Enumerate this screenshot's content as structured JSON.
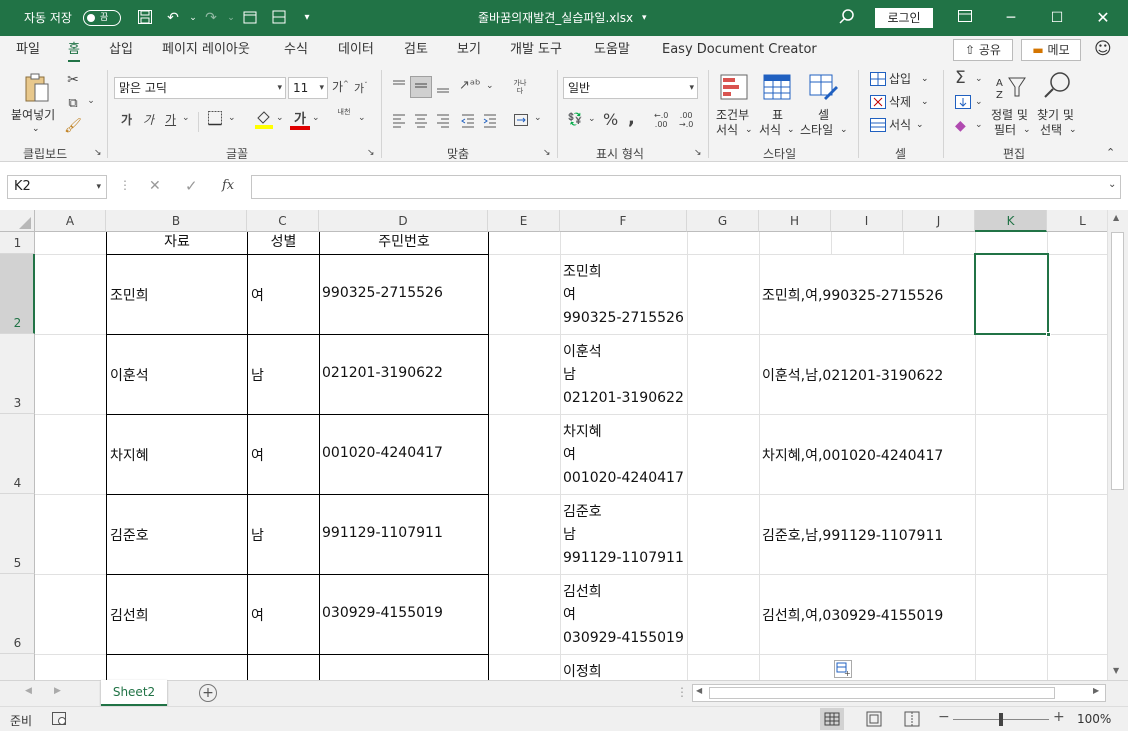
{
  "titlebar": {
    "autosave_label": "자동 저장",
    "autosave_state": "끔",
    "filename": "줄바꿈의재발견_실습파일.xlsx",
    "login_label": "로그인"
  },
  "tabs": [
    "파일",
    "홈",
    "삽입",
    "페이지 레이아웃",
    "수식",
    "데이터",
    "검토",
    "보기",
    "개발 도구",
    "도움말",
    "Easy Document Creator"
  ],
  "active_tab": "홈",
  "share_label": "공유",
  "memo_label": "메모",
  "ribbon": {
    "clipboard": {
      "paste_label": "붙여넣기",
      "group_label": "클립보드"
    },
    "font": {
      "name": "맑은 고딕",
      "size": "11",
      "group_label": "글꼴",
      "bold": "가",
      "italic": "가",
      "underline": "가",
      "font_color_glyph": "가",
      "phonetic": "내천"
    },
    "alignment": {
      "group_label": "맞춤",
      "wrap_glyph": "가나다"
    },
    "number": {
      "format": "일반",
      "group_label": "표시 형식"
    },
    "styles": {
      "conditional": [
        "조건부",
        "서식"
      ],
      "table": [
        "표",
        "서식"
      ],
      "cell": [
        "셀",
        "스타일"
      ],
      "group_label": "스타일"
    },
    "cells": {
      "insert": "삽입",
      "delete": "삭제",
      "format": "서식",
      "group_label": "셀"
    },
    "editing": {
      "sort": [
        "정렬 및",
        "필터"
      ],
      "find": [
        "찾기 및",
        "선택"
      ],
      "group_label": "편집"
    }
  },
  "formula_bar": {
    "name_box": "K2",
    "formula": ""
  },
  "columns": [
    "A",
    "B",
    "C",
    "D",
    "E",
    "F",
    "G",
    "H",
    "I",
    "J",
    "K",
    "L"
  ],
  "selected_column": "K",
  "selected_cell": "K2",
  "header_row": {
    "B": "자료",
    "C": "성별",
    "D": "주민번호"
  },
  "rows": [
    {
      "row": "2",
      "name": "조민희",
      "gender": "여",
      "id": "990325-2715526",
      "F": [
        "조민희",
        "여",
        "990325-2715526"
      ],
      "H": "조민희,여,990325-2715526"
    },
    {
      "row": "3",
      "name": "이훈석",
      "gender": "남",
      "id": "021201-3190622",
      "F": [
        "이훈석",
        "남",
        "021201-3190622"
      ],
      "H": "이훈석,남,021201-3190622"
    },
    {
      "row": "4",
      "name": "차지혜",
      "gender": "여",
      "id": "001020-4240417",
      "F": [
        "차지혜",
        "여",
        "001020-4240417"
      ],
      "H": "차지혜,여,001020-4240417"
    },
    {
      "row": "5",
      "name": "김준호",
      "gender": "남",
      "id": "991129-1107911",
      "F": [
        "김준호",
        "남",
        "991129-1107911"
      ],
      "H": "김준호,남,991129-1107911"
    },
    {
      "row": "6",
      "name": "김선희",
      "gender": "여",
      "id": "030929-4155019",
      "F": [
        "김선희",
        "여",
        "030929-4155019"
      ],
      "H": "김선희,여,030929-4155019"
    }
  ],
  "partial_row": {
    "F": "이정희"
  },
  "row1_label": "1",
  "sheet_tab": "Sheet2",
  "status": {
    "ready": "준비",
    "zoom": "100%"
  }
}
